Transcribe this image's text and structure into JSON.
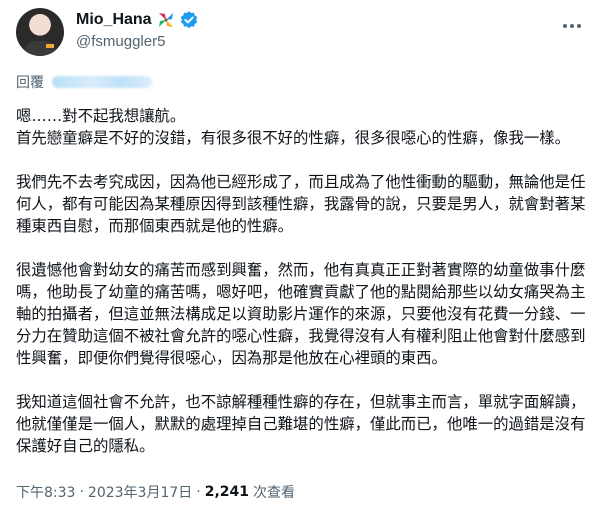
{
  "author": {
    "display_name": "Mio_Hana",
    "handle": "@fsmuggler5",
    "emoji_icon": "pinwheel-emoji-icon",
    "verified_icon": "verified-badge-icon",
    "colors": {
      "verified": "#1d9bf0",
      "secondary_text": "#536471",
      "primary_text": "#0f1419"
    }
  },
  "reply": {
    "label": "回覆"
  },
  "tweet": {
    "paragraphs": [
      "嗯……對不起我想讓航。\n首先戀童癖是不好的沒錯，有很多很不好的性癖，很多很噁心的性癖，像我一樣。",
      "我們先不去考究成因，因為他已經形成了，而且成為了他性衝動的驅動，無論他是任何人，都有可能因為某種原因得到該種性癖，我露骨的說，只要是男人，就會對著某種東西自慰，而那個東西就是他的性癖。",
      "很遺憾他會對幼女的痛苦而感到興奮，然而，他有真真正正對著實際的幼童做事什麼嗎，他助長了幼童的痛苦嗎，嗯好吧，他確實貢獻了他的點閱給那些以幼女痛哭為主軸的拍攝者，但這並無法構成足以資助影片運作的來源，只要他沒有花費一分錢、一分力在贊助這個不被社會允許的噁心性癖，我覺得沒有人有權利阻止他會對什麼感到性興奮，即便你們覺得很噁心，因為那是他放在心裡頭的東西。",
      "我知道這個社會不允許，也不諒解種種性癖的存在，但就事主而言，單就字面解讀，他就僅僅是一個人，默默的處理掉自己難堪的性癖，僅此而已，他唯一的過錯是沒有保護好自己的隱私。"
    ]
  },
  "meta": {
    "time": "下午8:33",
    "date": "2023年3月17日",
    "separator": "·",
    "views_count": "2,241",
    "views_label": "次查看"
  }
}
